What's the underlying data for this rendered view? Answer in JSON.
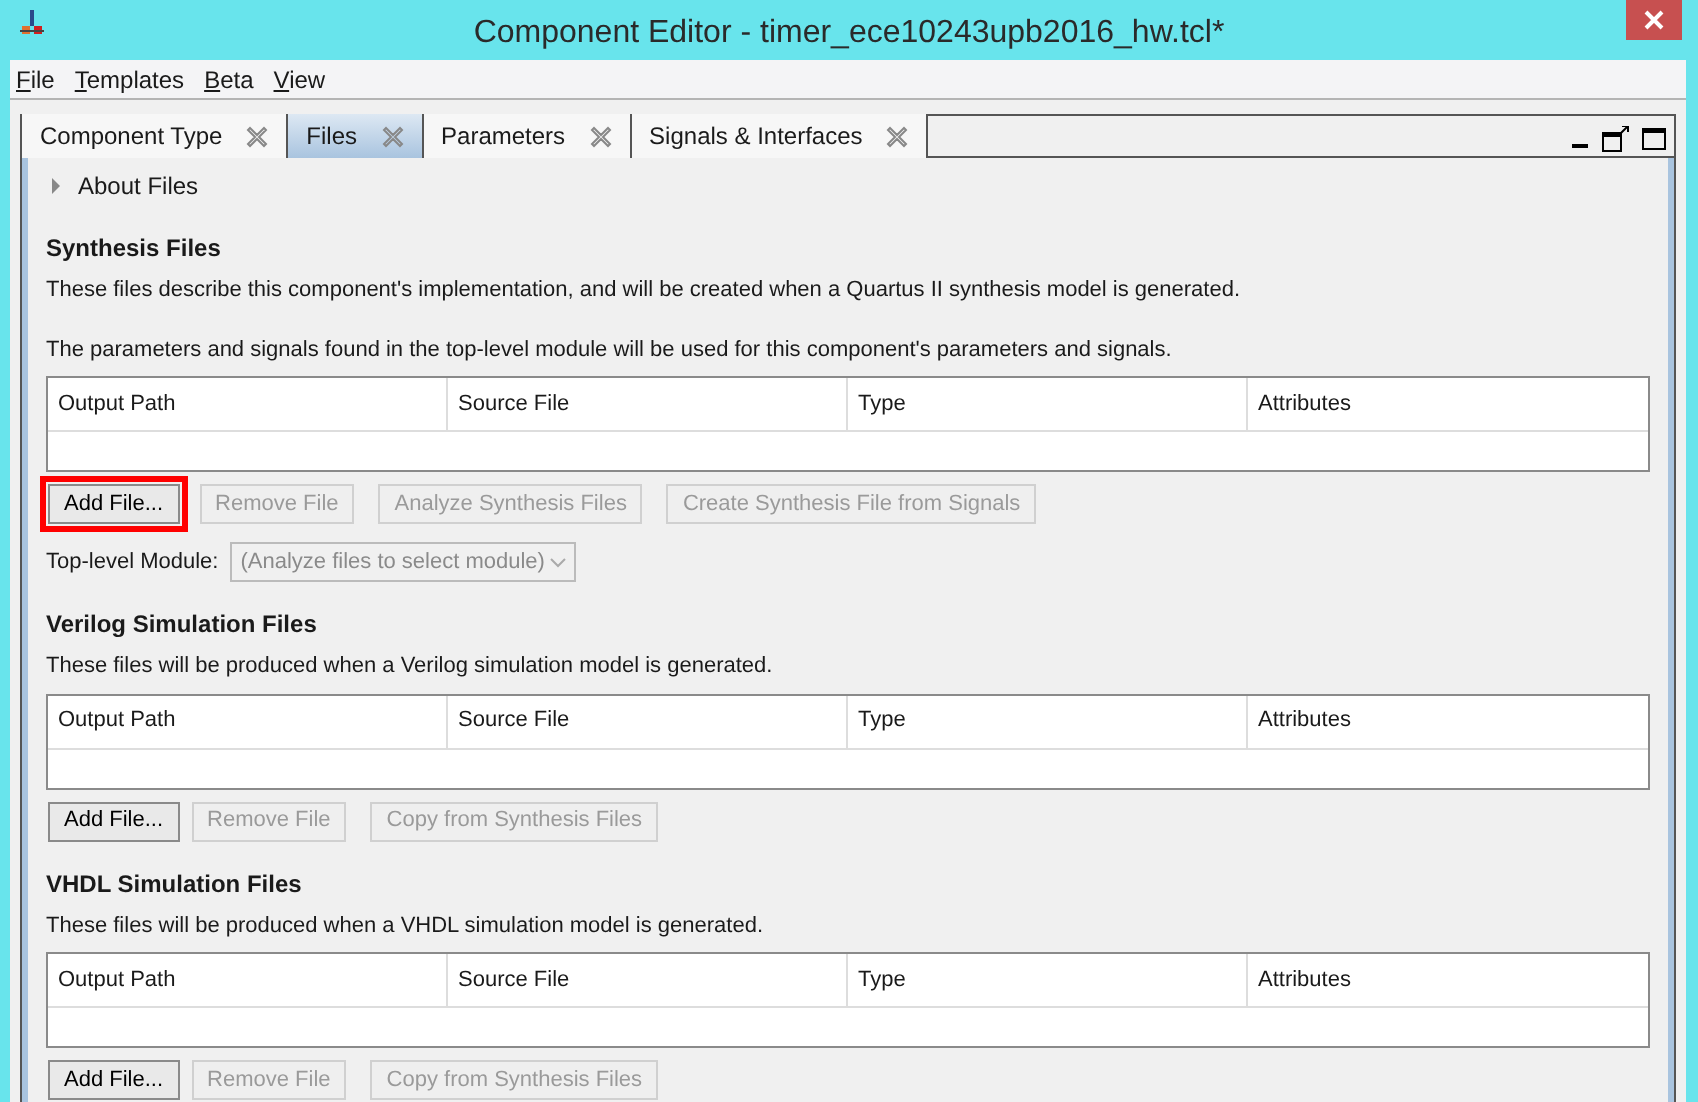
{
  "window": {
    "title": "Component Editor - timer_ece10243upb2016_hw.tcl*"
  },
  "menu": [
    "File",
    "Templates",
    "Beta",
    "View"
  ],
  "tabs": [
    {
      "label": "Component Type",
      "selected": false
    },
    {
      "label": "Files",
      "selected": true
    },
    {
      "label": "Parameters",
      "selected": false
    },
    {
      "label": "Signals & Interfaces",
      "selected": false
    }
  ],
  "about": {
    "label": "About Files",
    "expanded": false
  },
  "sections": [
    {
      "title": "Synthesis Files",
      "description": [
        "These files describe this component's implementation, and will be created when a Quartus II synthesis model is generated.",
        "The parameters and signals found in the top-level module will be used for this component's parameters and signals."
      ],
      "columns": [
        "Output Path",
        "Source File",
        "Type",
        "Attributes"
      ],
      "buttons": [
        {
          "label": "Add File...",
          "disabled": false,
          "highlighted": true
        },
        {
          "label": "Remove File",
          "disabled": true,
          "highlighted": false
        },
        {
          "label": "Analyze Synthesis Files",
          "disabled": true,
          "highlighted": false
        },
        {
          "label": "Create Synthesis File from Signals",
          "disabled": true,
          "highlighted": false
        }
      ],
      "module": {
        "label": "Top-level Module:",
        "value": "(Analyze files to select module)",
        "disabled": true
      }
    },
    {
      "title": "Verilog Simulation Files",
      "description": [
        "These files will be produced when a Verilog simulation model is generated."
      ],
      "columns": [
        "Output Path",
        "Source File",
        "Type",
        "Attributes"
      ],
      "buttons": [
        {
          "label": "Add File...",
          "disabled": false,
          "highlighted": false
        },
        {
          "label": "Remove File",
          "disabled": true,
          "highlighted": false
        },
        {
          "label": "Copy from Synthesis Files",
          "disabled": true,
          "highlighted": false
        }
      ]
    },
    {
      "title": "VHDL Simulation Files",
      "description": [
        "These files will be produced when a VHDL simulation model is generated."
      ],
      "columns": [
        "Output Path",
        "Source File",
        "Type",
        "Attributes"
      ],
      "buttons": [
        {
          "label": "Add File...",
          "disabled": false,
          "highlighted": false
        },
        {
          "label": "Remove File",
          "disabled": true,
          "highlighted": false
        },
        {
          "label": "Copy from Synthesis Files",
          "disabled": true,
          "highlighted": false
        }
      ]
    }
  ]
}
